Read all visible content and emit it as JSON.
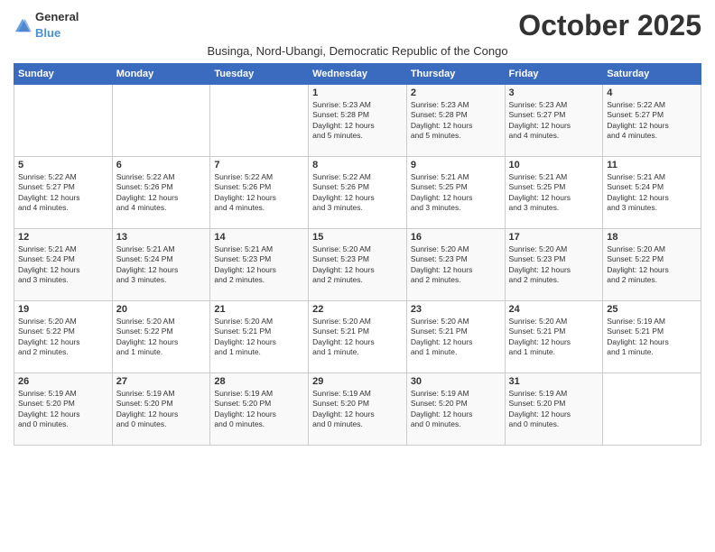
{
  "logo": {
    "general": "General",
    "blue": "Blue"
  },
  "title": "October 2025",
  "subtitle": "Businga, Nord-Ubangi, Democratic Republic of the Congo",
  "weekdays": [
    "Sunday",
    "Monday",
    "Tuesday",
    "Wednesday",
    "Thursday",
    "Friday",
    "Saturday"
  ],
  "weeks": [
    [
      {
        "day": "",
        "info": ""
      },
      {
        "day": "",
        "info": ""
      },
      {
        "day": "",
        "info": ""
      },
      {
        "day": "1",
        "info": "Sunrise: 5:23 AM\nSunset: 5:28 PM\nDaylight: 12 hours\nand 5 minutes."
      },
      {
        "day": "2",
        "info": "Sunrise: 5:23 AM\nSunset: 5:28 PM\nDaylight: 12 hours\nand 5 minutes."
      },
      {
        "day": "3",
        "info": "Sunrise: 5:23 AM\nSunset: 5:27 PM\nDaylight: 12 hours\nand 4 minutes."
      },
      {
        "day": "4",
        "info": "Sunrise: 5:22 AM\nSunset: 5:27 PM\nDaylight: 12 hours\nand 4 minutes."
      }
    ],
    [
      {
        "day": "5",
        "info": "Sunrise: 5:22 AM\nSunset: 5:27 PM\nDaylight: 12 hours\nand 4 minutes."
      },
      {
        "day": "6",
        "info": "Sunrise: 5:22 AM\nSunset: 5:26 PM\nDaylight: 12 hours\nand 4 minutes."
      },
      {
        "day": "7",
        "info": "Sunrise: 5:22 AM\nSunset: 5:26 PM\nDaylight: 12 hours\nand 4 minutes."
      },
      {
        "day": "8",
        "info": "Sunrise: 5:22 AM\nSunset: 5:26 PM\nDaylight: 12 hours\nand 3 minutes."
      },
      {
        "day": "9",
        "info": "Sunrise: 5:21 AM\nSunset: 5:25 PM\nDaylight: 12 hours\nand 3 minutes."
      },
      {
        "day": "10",
        "info": "Sunrise: 5:21 AM\nSunset: 5:25 PM\nDaylight: 12 hours\nand 3 minutes."
      },
      {
        "day": "11",
        "info": "Sunrise: 5:21 AM\nSunset: 5:24 PM\nDaylight: 12 hours\nand 3 minutes."
      }
    ],
    [
      {
        "day": "12",
        "info": "Sunrise: 5:21 AM\nSunset: 5:24 PM\nDaylight: 12 hours\nand 3 minutes."
      },
      {
        "day": "13",
        "info": "Sunrise: 5:21 AM\nSunset: 5:24 PM\nDaylight: 12 hours\nand 3 minutes."
      },
      {
        "day": "14",
        "info": "Sunrise: 5:21 AM\nSunset: 5:23 PM\nDaylight: 12 hours\nand 2 minutes."
      },
      {
        "day": "15",
        "info": "Sunrise: 5:20 AM\nSunset: 5:23 PM\nDaylight: 12 hours\nand 2 minutes."
      },
      {
        "day": "16",
        "info": "Sunrise: 5:20 AM\nSunset: 5:23 PM\nDaylight: 12 hours\nand 2 minutes."
      },
      {
        "day": "17",
        "info": "Sunrise: 5:20 AM\nSunset: 5:23 PM\nDaylight: 12 hours\nand 2 minutes."
      },
      {
        "day": "18",
        "info": "Sunrise: 5:20 AM\nSunset: 5:22 PM\nDaylight: 12 hours\nand 2 minutes."
      }
    ],
    [
      {
        "day": "19",
        "info": "Sunrise: 5:20 AM\nSunset: 5:22 PM\nDaylight: 12 hours\nand 2 minutes."
      },
      {
        "day": "20",
        "info": "Sunrise: 5:20 AM\nSunset: 5:22 PM\nDaylight: 12 hours\nand 1 minute."
      },
      {
        "day": "21",
        "info": "Sunrise: 5:20 AM\nSunset: 5:21 PM\nDaylight: 12 hours\nand 1 minute."
      },
      {
        "day": "22",
        "info": "Sunrise: 5:20 AM\nSunset: 5:21 PM\nDaylight: 12 hours\nand 1 minute."
      },
      {
        "day": "23",
        "info": "Sunrise: 5:20 AM\nSunset: 5:21 PM\nDaylight: 12 hours\nand 1 minute."
      },
      {
        "day": "24",
        "info": "Sunrise: 5:20 AM\nSunset: 5:21 PM\nDaylight: 12 hours\nand 1 minute."
      },
      {
        "day": "25",
        "info": "Sunrise: 5:19 AM\nSunset: 5:21 PM\nDaylight: 12 hours\nand 1 minute."
      }
    ],
    [
      {
        "day": "26",
        "info": "Sunrise: 5:19 AM\nSunset: 5:20 PM\nDaylight: 12 hours\nand 0 minutes."
      },
      {
        "day": "27",
        "info": "Sunrise: 5:19 AM\nSunset: 5:20 PM\nDaylight: 12 hours\nand 0 minutes."
      },
      {
        "day": "28",
        "info": "Sunrise: 5:19 AM\nSunset: 5:20 PM\nDaylight: 12 hours\nand 0 minutes."
      },
      {
        "day": "29",
        "info": "Sunrise: 5:19 AM\nSunset: 5:20 PM\nDaylight: 12 hours\nand 0 minutes."
      },
      {
        "day": "30",
        "info": "Sunrise: 5:19 AM\nSunset: 5:20 PM\nDaylight: 12 hours\nand 0 minutes."
      },
      {
        "day": "31",
        "info": "Sunrise: 5:19 AM\nSunset: 5:20 PM\nDaylight: 12 hours\nand 0 minutes."
      },
      {
        "day": "",
        "info": ""
      }
    ]
  ]
}
